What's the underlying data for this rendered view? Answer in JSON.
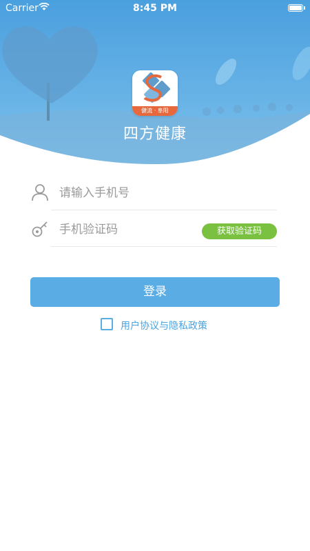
{
  "status_bar": {
    "carrier": "Carrier",
    "time": "8:45 PM"
  },
  "app": {
    "name": "四方健康",
    "logo_band_text": "健流 · 阜阳"
  },
  "login_form": {
    "phone_placeholder": "请输入手机号",
    "code_placeholder": "手机验证码",
    "get_code_label": "获取验证码",
    "login_label": "登录",
    "agreement_label": "用户协议与隐私政策"
  },
  "colors": {
    "header_blue": "#5aace5",
    "accent_green": "#7ac142",
    "logo_orange": "#e6683c"
  }
}
